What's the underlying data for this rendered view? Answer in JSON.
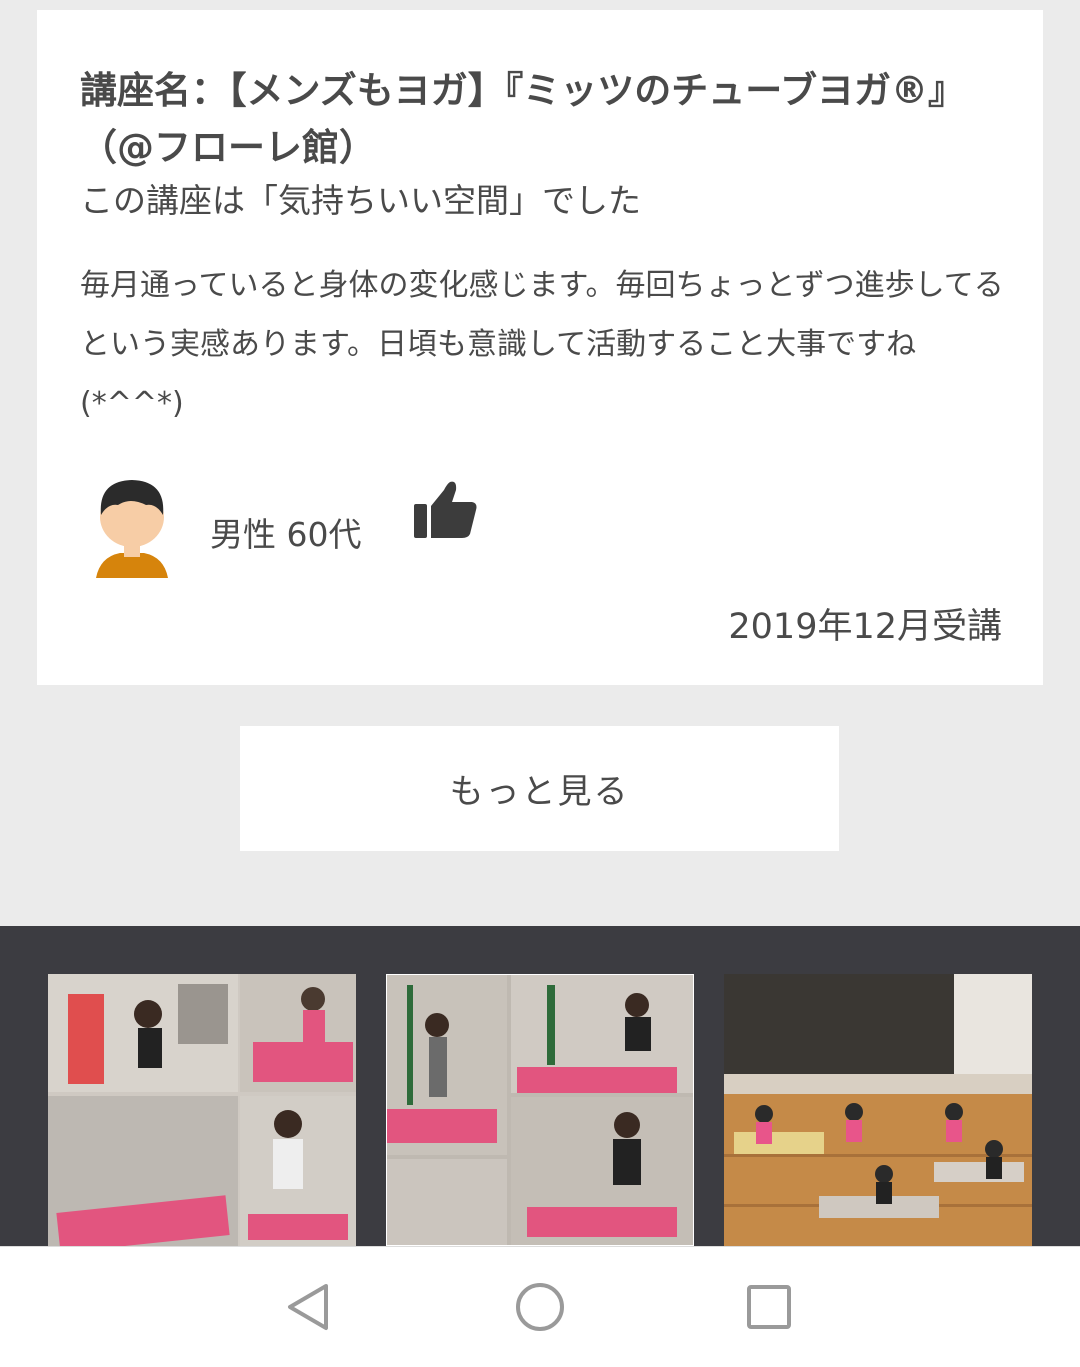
{
  "review": {
    "course_title": "講座名：【メンズもヨガ】『ミッツのチューブヨガ®』（@フローレ館）",
    "rating_text": "この講座は「気持ちいい空間」でした",
    "comment": "毎月通っていると身体の変化感じます。毎回ちょっとずつ進歩してるという実感あります。日頃も意識して活動すること大事ですね(*^^*)",
    "user": "男性 60代",
    "attended": "2019年12月受講",
    "avatar_icon": "male-user-avatar-icon",
    "like_icon": "thumbs-up-icon"
  },
  "more_button": {
    "label": "もっと見る"
  },
  "gallery": [
    {
      "icon": "yoga-class-photo-1"
    },
    {
      "icon": "yoga-class-photo-2"
    },
    {
      "icon": "gym-hall-yoga-photo-3"
    }
  ],
  "navbar": {
    "back": "back-triangle-icon",
    "home": "home-circle-icon",
    "recents": "recents-square-icon"
  },
  "colors": {
    "background": "#ebebeb",
    "card": "#ffffff",
    "text": "#4a4a4a",
    "footer_band": "#3c3c41",
    "mat_pink": "#e2557f",
    "avatar_shirt": "#d6840c"
  }
}
